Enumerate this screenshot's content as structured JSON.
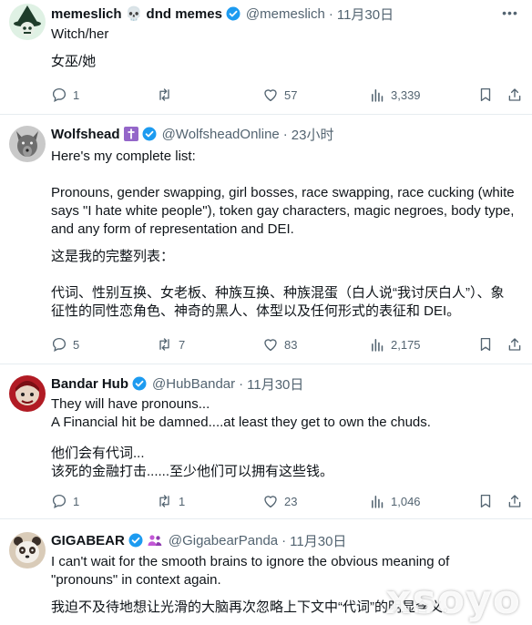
{
  "tweets": [
    {
      "name": "memeslich 💀 dnd memes",
      "handle": "@memeslich",
      "sep": "·",
      "time": "11月30日",
      "body": [
        "Witch/her",
        "女巫/她"
      ],
      "replies": "1",
      "retweets": "",
      "likes": "57",
      "views": "3,339"
    },
    {
      "name": "Wolfshead",
      "handle": "@WolfsheadOnline",
      "sep": "·",
      "time": "23小时",
      "body": [
        "Here's my complete list:",
        "Pronouns, gender swapping, girl bosses, race swapping, race cucking (white says \"I hate white people\"), token gay characters, magic negroes, body type, and any form of representation and DEI.",
        "这是我的完整列表：",
        "代词、性别互换、女老板、种族互换、种族混蛋（白人说“我讨厌白人”）、象征性的同性恋角色、神奇的黑人、体型以及任何形式的表征和 DEI。"
      ],
      "replies": "5",
      "retweets": "7",
      "likes": "83",
      "views": "2,175"
    },
    {
      "name": "Bandar Hub",
      "handle": "@HubBandar",
      "sep": "·",
      "time": "11月30日",
      "body": [
        "They will have pronouns...\nA Financial hit be damned....at least they get to own the chuds.",
        "他们会有代词...\n该死的金融打击......至少他们可以拥有这些钱。"
      ],
      "replies": "1",
      "retweets": "1",
      "likes": "23",
      "views": "1,046"
    },
    {
      "name": "GIGABEAR",
      "handle": "@GigabearPanda",
      "sep": "·",
      "time": "11月30日",
      "body": [
        "I can't wait for the smooth brains to ignore the obvious meaning of \"pronouns\" in context again.",
        "我迫不及待地想让光滑的大脑再次忽略上下文中“代词”的明显含义。"
      ]
    }
  ],
  "watermark": "xsoyo",
  "colors": {
    "verified": "#1d9bf0",
    "muted": "#536471",
    "text": "#0f1419",
    "cross_badge": "#9466c9"
  }
}
